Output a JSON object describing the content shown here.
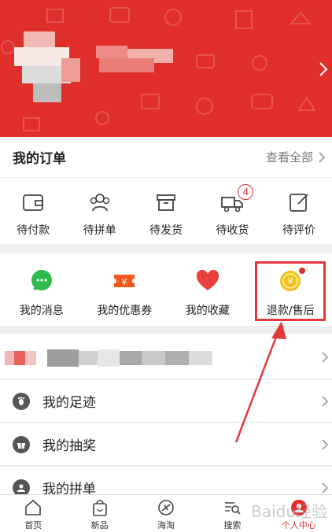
{
  "orders": {
    "title": "我的订单",
    "view_all": "查看全部",
    "items": [
      {
        "label": "待付款",
        "icon": "wallet-icon"
      },
      {
        "label": "待拼单",
        "icon": "group-icon"
      },
      {
        "label": "待发货",
        "icon": "box-icon"
      },
      {
        "label": "待收货",
        "icon": "truck-icon",
        "badge": "4"
      },
      {
        "label": "待评价",
        "icon": "review-icon"
      }
    ]
  },
  "services": [
    {
      "label": "我的消息",
      "icon": "chat-icon",
      "color": "#2dbb4e"
    },
    {
      "label": "我的优惠券",
      "icon": "coupon-icon",
      "color": "#f3591d"
    },
    {
      "label": "我的收藏",
      "icon": "heart-icon",
      "color": "#e8403b"
    },
    {
      "label": "退款/售后",
      "icon": "refund-coin-icon",
      "color": "#f2c21c"
    }
  ],
  "list": [
    {
      "label": "我的足迹",
      "icon": "footprint-icon"
    },
    {
      "label": "我的抽奖",
      "icon": "gift-icon"
    },
    {
      "label": "我的拼单",
      "icon": "group-order-icon"
    }
  ],
  "tabbar": [
    {
      "label": "首页",
      "icon": "home-icon"
    },
    {
      "label": "新品",
      "icon": "bag-icon"
    },
    {
      "label": "海淘",
      "icon": "plane-icon"
    },
    {
      "label": "搜索",
      "icon": "search-icon"
    },
    {
      "label": "个人中心",
      "icon": "user-icon",
      "active": true
    }
  ],
  "watermark": "Baidu经验",
  "colors": {
    "brand": "#e02e2b",
    "highlight": "#e03b3b"
  }
}
